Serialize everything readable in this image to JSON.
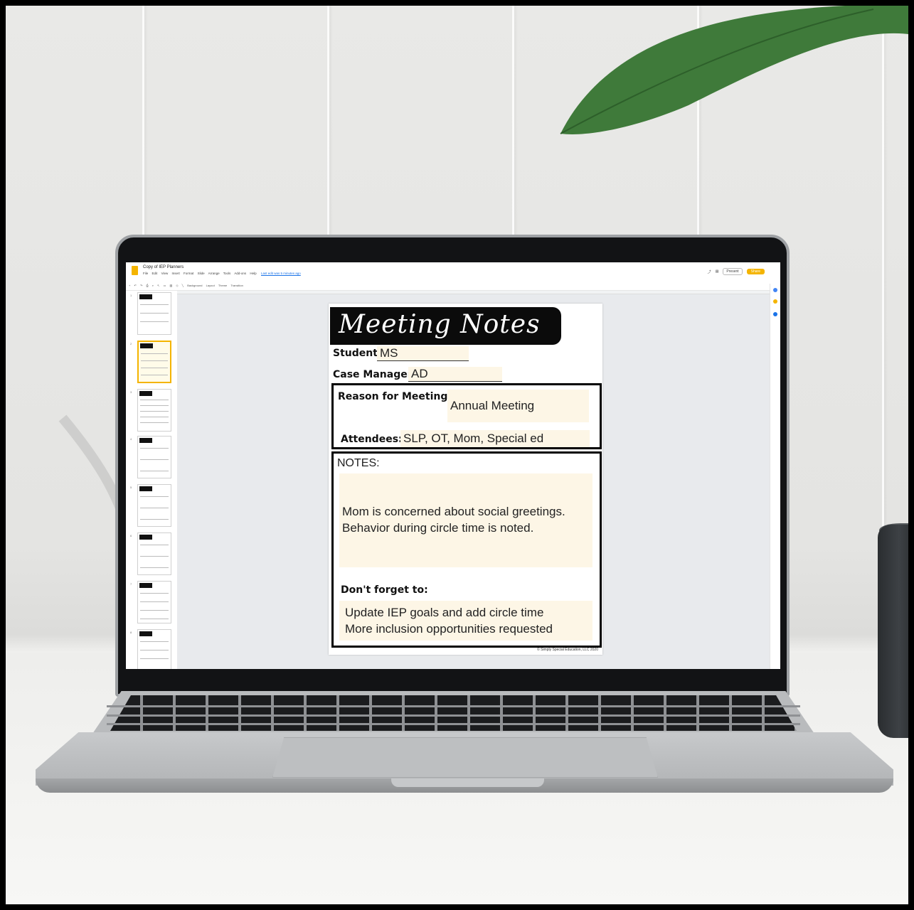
{
  "app": {
    "doc_title": "Copy of IEP Planners",
    "menus": [
      "File",
      "Edit",
      "View",
      "Insert",
      "Format",
      "Slide",
      "Arrange",
      "Tools",
      "Add-ons",
      "Help"
    ],
    "last_edit": "Last edit was 5 minutes ago",
    "present_label": "Present",
    "share_label": "Share",
    "toolbar": [
      "Background",
      "Layout",
      "Theme",
      "Transition"
    ]
  },
  "slide": {
    "title": "Meeting Notes",
    "student_label": "Student:",
    "student_value": "MS",
    "case_manager_label": "Case Manager:",
    "case_manager_value": "AD",
    "reason_label": "Reason for Meeting:",
    "reason_value": "Annual Meeting",
    "attendees_label": "Attendees:",
    "attendees_value": "SLP, OT, Mom, Special ed",
    "notes_label": "NOTES:",
    "notes_line1": "Mom is concerned about social greetings.",
    "notes_line2": "Behavior during circle time is noted.",
    "dont_forget_label": "Don't forget to:",
    "dont_forget_line1": "Update IEP goals and add circle time",
    "dont_forget_line2": "More inclusion opportunities requested",
    "copyright": "© Simply Special Education, LLC 2020"
  },
  "filmstrip": {
    "slide_numbers": [
      "1",
      "2",
      "3",
      "4",
      "5",
      "6",
      "7",
      "8"
    ],
    "selected": "2"
  },
  "colors": {
    "field_bg": "#fdf6e6",
    "accent": "#f4b400",
    "banner": "#0b0b0b"
  }
}
